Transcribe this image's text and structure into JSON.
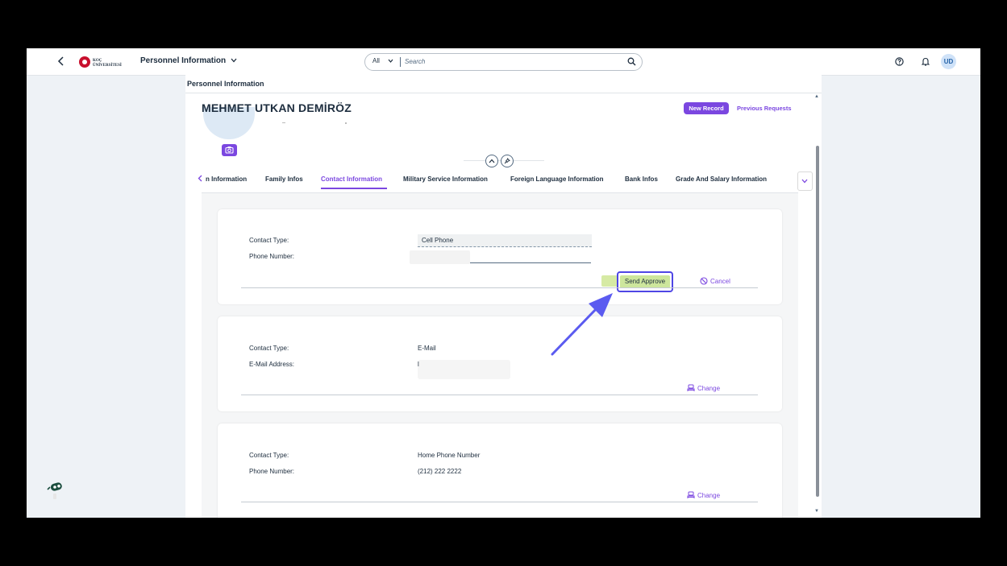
{
  "shellbar": {
    "back_icon": "chevron-left-icon",
    "logo_text_line1": "KOÇ",
    "logo_text_line2": "ÜNİVERSİTESİ",
    "app_title": "Personnel Information",
    "search": {
      "scope": "All",
      "placeholder": "Search"
    },
    "user_initials": "UD"
  },
  "page": {
    "title": "Personnel Information",
    "employee_name": "MEHMET UTKAN DEMİRÖZ",
    "new_record_label": "New Record",
    "previous_requests_label": "Previous Requests"
  },
  "tabs": {
    "items": [
      {
        "label": "n Information"
      },
      {
        "label": "Family Infos"
      },
      {
        "label": "Contact Information",
        "active": true
      },
      {
        "label": "Military Service Information"
      },
      {
        "label": "Foreign Language Information"
      },
      {
        "label": "Bank Infos"
      },
      {
        "label": "Grade And Salary Information"
      }
    ]
  },
  "cards": [
    {
      "contact_type_label": "Contact Type:",
      "contact_type_value": "Cell Phone",
      "phone_label": "Phone Number:",
      "phone_value": "",
      "send_approve_label": "Send Approve",
      "cancel_label": "Cancel"
    },
    {
      "contact_type_label": "Contact Type:",
      "contact_type_value": "E-Mail",
      "email_label": "E-Mail Address:",
      "email_value": "l",
      "change_label": "Change"
    },
    {
      "contact_type_label": "Contact Type:",
      "contact_type_value": "Home Phone Number",
      "phone_label": "Phone Number:",
      "phone_value": "(212) 222 2222",
      "change_label": "Change"
    }
  ],
  "colors": {
    "accent": "#7b47e0",
    "highlight_border": "#4f46e5",
    "approve_fill": "#cde69c",
    "arrow": "#5b5bf0"
  }
}
